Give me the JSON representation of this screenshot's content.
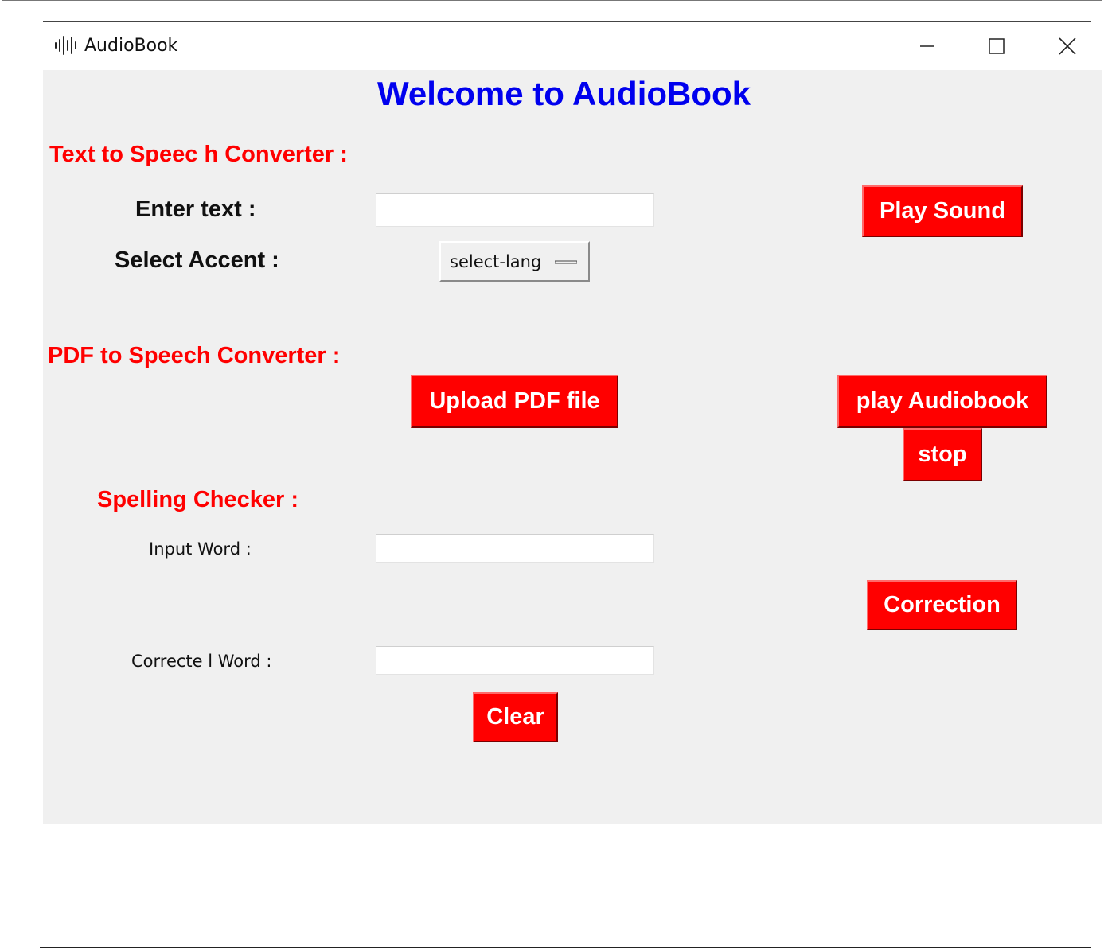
{
  "window": {
    "title": "AudioBook",
    "icon": "sound-wave-icon",
    "controls": [
      "minimize-icon",
      "maximize-icon",
      "close-icon"
    ]
  },
  "main": {
    "heading": "Welcome to AudioBook",
    "tts": {
      "section_title": "Text to Speec h Converter :",
      "enter_text_label": "Enter text :",
      "text_value": "",
      "accent_label": "Select Accent :",
      "accent_selected": "select-lang",
      "play_sound_label": "Play Sound"
    },
    "pdf": {
      "section_title": "PDF to Speech Converter :",
      "upload_label": "Upload PDF file",
      "play_audiobook_label": "play Audiobook",
      "stop_label": "stop"
    },
    "spelling": {
      "section_title": "Spelling Checker :",
      "input_word_label": "Input Word :",
      "input_word_value": "",
      "corrected_word_label": "Correcte l Word :",
      "corrected_word_value": "",
      "correction_label": "Correction",
      "clear_label": "Clear"
    }
  },
  "colors": {
    "heading": "#0000ee",
    "section": "#ff0000",
    "button_bg": "#ff0000",
    "button_text": "#ffffff",
    "client_bg": "#f0f0f0"
  }
}
